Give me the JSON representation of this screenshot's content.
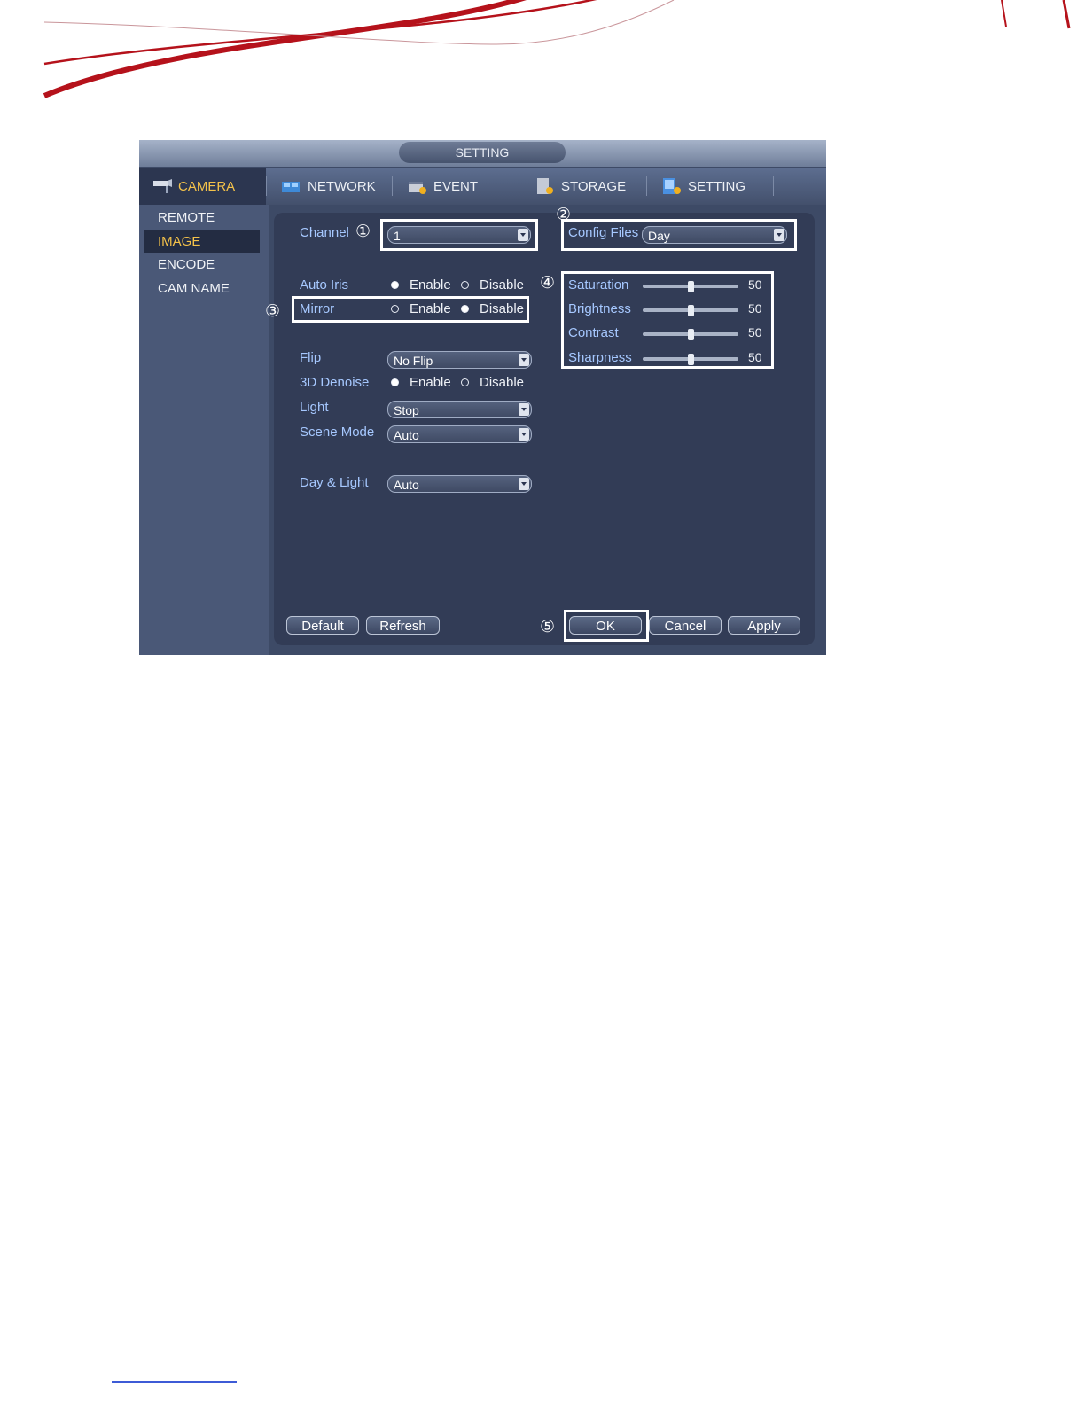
{
  "window": {
    "title": "SETTING"
  },
  "tabs": [
    {
      "label": "CAMERA",
      "icon": "camera-icon",
      "active": true
    },
    {
      "label": "NETWORK",
      "icon": "network-icon"
    },
    {
      "label": "EVENT",
      "icon": "event-icon"
    },
    {
      "label": "STORAGE",
      "icon": "storage-icon"
    },
    {
      "label": "SETTING",
      "icon": "settings-icon"
    }
  ],
  "sidebar": {
    "items": [
      {
        "label": "REMOTE"
      },
      {
        "label": "IMAGE",
        "active": true
      },
      {
        "label": "ENCODE"
      },
      {
        "label": "CAM NAME"
      }
    ]
  },
  "form": {
    "channel": {
      "label": "Channel",
      "value": "1"
    },
    "config_files": {
      "label": "Config Files",
      "value": "Day"
    },
    "auto_iris": {
      "label": "Auto Iris",
      "enable": "Enable",
      "disable": "Disable",
      "selected": "Enable"
    },
    "mirror": {
      "label": "Mirror",
      "enable": "Enable",
      "disable": "Disable",
      "selected": "Disable"
    },
    "flip": {
      "label": "Flip",
      "value": "No Flip"
    },
    "denoise": {
      "label": "3D Denoise",
      "enable": "Enable",
      "disable": "Disable",
      "selected": "Enable"
    },
    "light": {
      "label": "Light",
      "value": "Stop"
    },
    "scene_mode": {
      "label": "Scene Mode",
      "value": "Auto"
    },
    "day_light": {
      "label": "Day & Light",
      "value": "Auto"
    }
  },
  "sliders": [
    {
      "label": "Saturation",
      "value": "50",
      "level": 0.5
    },
    {
      "label": "Brightness",
      "value": "50",
      "level": 0.5
    },
    {
      "label": "Contrast",
      "value": "50",
      "level": 0.5
    },
    {
      "label": "Sharpness",
      "value": "50",
      "level": 0.5
    }
  ],
  "buttons": {
    "default": "Default",
    "refresh": "Refresh",
    "ok": "OK",
    "cancel": "Cancel",
    "apply": "Apply"
  },
  "callouts": [
    "①",
    "②",
    "③",
    "④",
    "⑤"
  ],
  "colors": {
    "accent_red": "#b5121b",
    "active_tab": "#f4c24a",
    "label_blue": "#a6c8ff"
  }
}
